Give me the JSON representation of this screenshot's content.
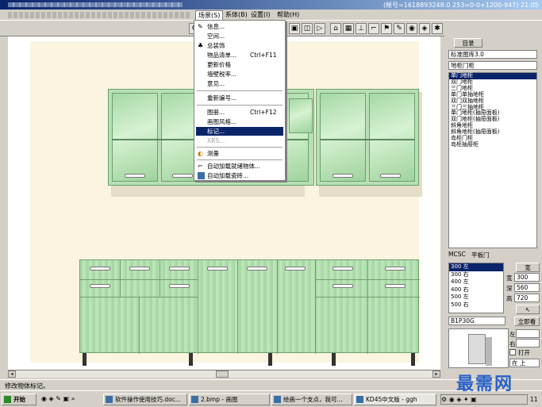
{
  "window": {
    "title_info": "(帐号=1618893248:0 253=0-0+1200-947) 21:05"
  },
  "menubar": {
    "items": [
      "场景(S)",
      "系体(B)",
      "设置(I)",
      "帮助(H)"
    ]
  },
  "dropdown": {
    "items": [
      {
        "label": "信息...",
        "icon": "info-icon"
      },
      {
        "label": "空间...",
        "icon": ""
      },
      {
        "label": "总装饰",
        "icon": "decor-icon"
      },
      {
        "label": "物品清单...",
        "shortcut": "Ctrl+F11"
      },
      {
        "label": "更新价格"
      },
      {
        "label": "墙壁税率..."
      },
      {
        "label": "意见..."
      },
      {
        "label": "重新编号..."
      },
      {
        "label": "图册...",
        "shortcut": "Ctrl+F12"
      },
      {
        "label": "画图风格..."
      },
      {
        "label": "标记...",
        "selected": true
      },
      {
        "label": "XRS...",
        "disabled": true
      },
      {
        "label": "测量",
        "icon": "measure-icon"
      },
      {
        "label": "自动加载就绪物体...",
        "icon": "checkbox-icon"
      },
      {
        "label": "自动加载瓷砖...",
        "icon": "tile-icon"
      }
    ]
  },
  "right_panel": {
    "tab_label": "目录",
    "library": "标准图库3.0",
    "category": "地柜门柜",
    "items": [
      "单门地柜",
      "双门地柜",
      "三门地柜",
      "单门单抽地柜",
      "双门双抽地柜",
      "三门三抽地柜",
      "单门地柜(抽屉面板)",
      "双门地柜(抽屉面板)",
      "斜角地柜",
      "斜角地柜(抽屉面板)",
      "岛柜门柜",
      "岛柜抽屉柜"
    ],
    "code": "MCSC",
    "door_type": "平板门",
    "sizes": [
      "300 左",
      "300 右",
      "400 左",
      "400 右",
      "500 左",
      "500 右"
    ],
    "width_label": "宽",
    "depth_label": "深",
    "height_label": "高",
    "width_value": "300",
    "depth_value": "560",
    "height_value": "720",
    "model": "B1P30G",
    "stand_label": "立即看",
    "left_label": "左",
    "right_label": "右",
    "open_label": "打开",
    "position": "在 上"
  },
  "status": {
    "text": "修改物体标记。"
  },
  "taskbar": {
    "start": "开始",
    "tasks": [
      "软件操作使用技巧.doc...",
      "2.bmp - 画图",
      "绘画一个支点，我可...",
      "KD45中文版 - ggh"
    ],
    "clock": "11"
  },
  "watermark": "最需网",
  "colors": {
    "cabinet": "#b8e0b4",
    "selection": "#0a246a",
    "wall": "#fbf4e1"
  }
}
